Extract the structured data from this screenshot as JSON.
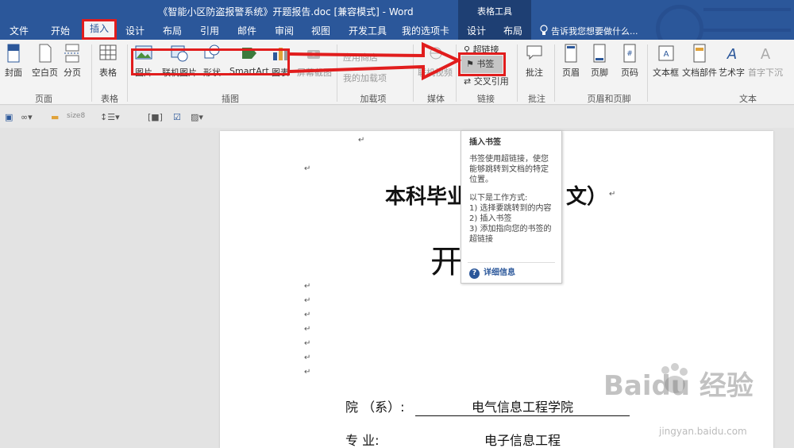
{
  "window": {
    "title": "《智能小区防盗报警系统》开题报告.doc [兼容模式] - Word",
    "context_tab_group": "表格工具"
  },
  "tabs": [
    {
      "label": "文件"
    },
    {
      "label": "开始"
    },
    {
      "label": "插入",
      "active": true
    },
    {
      "label": "设计"
    },
    {
      "label": "布局"
    },
    {
      "label": "引用"
    },
    {
      "label": "邮件"
    },
    {
      "label": "审阅"
    },
    {
      "label": "视图"
    },
    {
      "label": "开发工具"
    },
    {
      "label": "我的选项卡"
    },
    {
      "label": "设计"
    },
    {
      "label": "布局"
    }
  ],
  "tell_me": "告诉我您想要做什么...",
  "ribbon": {
    "page_group": {
      "cover": "封面",
      "blank_page": "空白页",
      "page_break": "分页",
      "label": "页面"
    },
    "table_group": {
      "table": "表格",
      "label": "表格"
    },
    "illustrations": {
      "picture": "图片",
      "online_picture": "联机图片",
      "shapes": "形状",
      "smartart": "SmartArt",
      "chart": "图表",
      "screenshot": "屏幕截图",
      "label": "插图"
    },
    "addins": {
      "store": "应用商店",
      "my_addins": "我的加载项",
      "label": "加载项"
    },
    "media": {
      "online_video": "联机视频",
      "label": "媒体"
    },
    "links": {
      "hyperlink": "超链接",
      "bookmark": "书签",
      "cross_ref": "交叉引用",
      "label": "链接"
    },
    "comments": {
      "comment": "批注",
      "label": "批注"
    },
    "header_footer": {
      "header": "页眉",
      "footer": "页脚",
      "page_number": "页码",
      "label": "页眉和页脚"
    },
    "text": {
      "textbox": "文本框",
      "quick_parts": "文档部件",
      "wordart": "艺术字",
      "dropcap": "首字下沉",
      "label": "文本"
    }
  },
  "qat": {
    "font_size": "size8"
  },
  "document": {
    "title1": "本科毕业",
    "title1_tail": "文）",
    "title2": "开",
    "fields": [
      {
        "label": "院   （系）:",
        "value": "电气信息工程学院"
      },
      {
        "label": "专      业:",
        "value": "电子信息工程"
      }
    ],
    "para_mark": "↵"
  },
  "tooltip": {
    "title": "插入书签",
    "body": "书签使用超链接，使您能够跳转到文档的特定位置。",
    "howto": "以下是工作方式:\n1) 选择要跳转到的内容\n2) 插入书签\n3) 添加指向您的书签的超链接",
    "more": "详细信息"
  },
  "watermark": {
    "brand": "Baidu 经验",
    "url": "jingyan.baidu.com"
  },
  "colors": {
    "accent": "#2b579a",
    "highlight": "#e11d1d"
  }
}
